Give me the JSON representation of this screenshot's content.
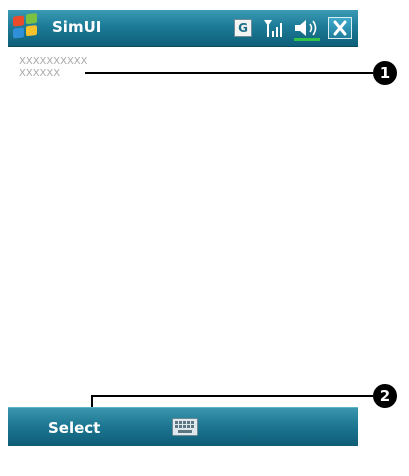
{
  "titlebar": {
    "title": "SimUI",
    "start_icon": "windows-flag-icon",
    "g_label": "G",
    "signal_icon": "signal-antenna-icon",
    "volume_icon": "speaker-volume-icon",
    "close_icon": "close-icon"
  },
  "content": {
    "line1": "XXXXXXXXXX",
    "line2": "XXXXXX"
  },
  "callouts": {
    "first": "1",
    "second": "2"
  },
  "menubar": {
    "left_softkey": "Select",
    "keyboard_icon": "keyboard-icon"
  },
  "colors": {
    "bar_accent": "#1c7b97",
    "text_gray": "#a8a8a8"
  }
}
